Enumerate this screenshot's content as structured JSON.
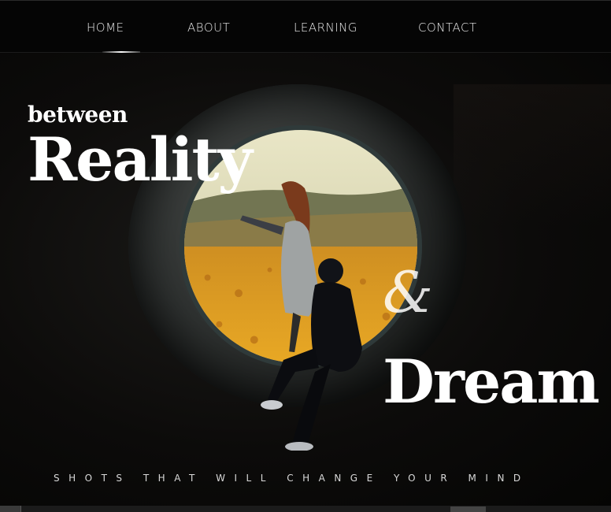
{
  "nav": {
    "items": [
      {
        "label": "HOME",
        "active": true
      },
      {
        "label": "ABOUT",
        "active": false
      },
      {
        "label": "LEARNING",
        "active": false
      },
      {
        "label": "CONTACT",
        "active": false
      }
    ]
  },
  "hero": {
    "kicker": "between",
    "word1": "Reality",
    "ampersand": "&",
    "word2": "Dream",
    "tagline": "SHOTS THAT WILL CHANGE YOUR MIND"
  },
  "colors": {
    "background": "#080706",
    "text": "#ffffff",
    "field": "#e2a21f",
    "sky": "#e9e6c6"
  }
}
